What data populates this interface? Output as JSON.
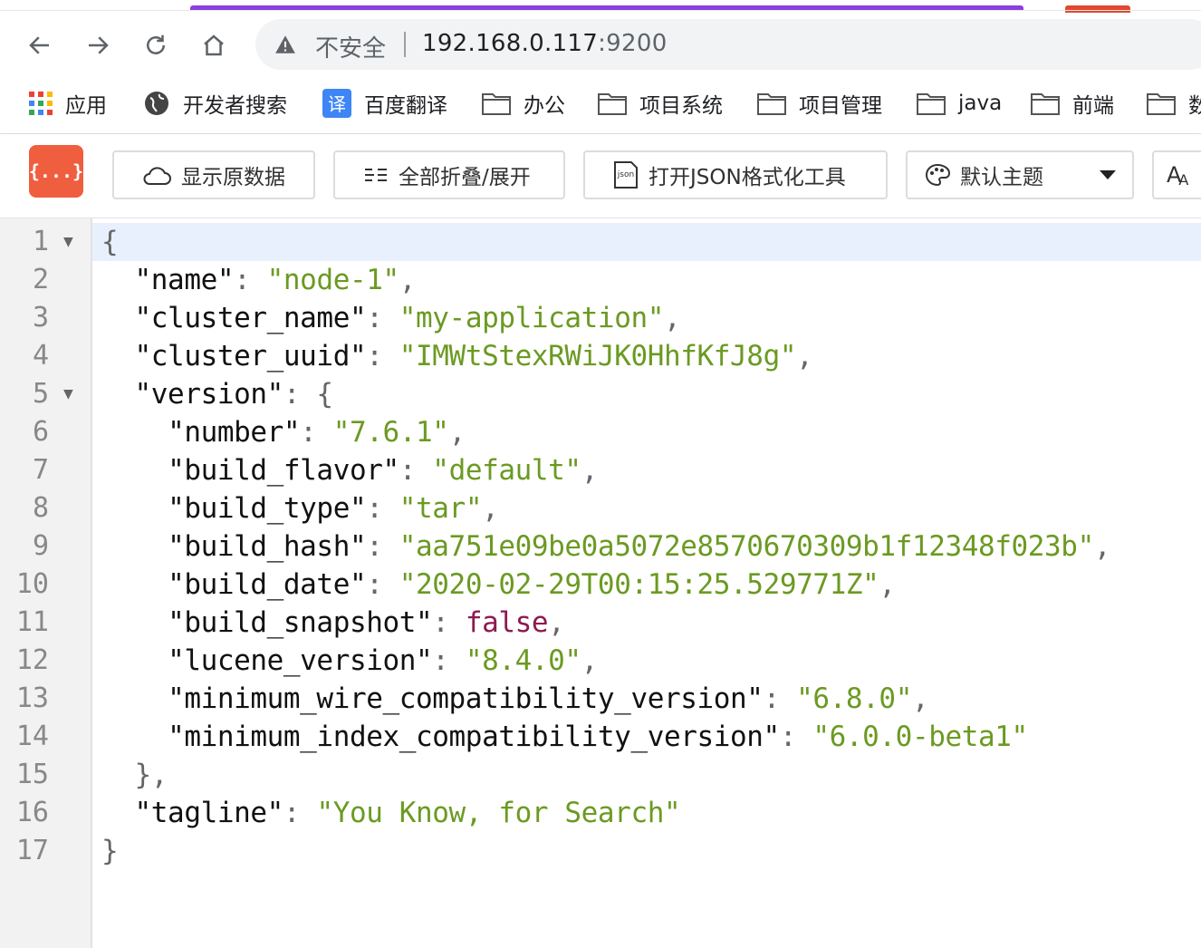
{
  "browser": {
    "insecure_label": "不安全",
    "url_host": "192.168.0.117",
    "url_port": ":9200"
  },
  "bookmarks": [
    {
      "label": "应用",
      "icon": "apps-grid-icon"
    },
    {
      "label": "开发者搜索",
      "icon": "globe-icon"
    },
    {
      "label": "百度翻译",
      "icon": "translate-icon"
    },
    {
      "label": "办公",
      "icon": "folder-icon"
    },
    {
      "label": "项目系统",
      "icon": "folder-icon"
    },
    {
      "label": "项目管理",
      "icon": "folder-icon"
    },
    {
      "label": "java",
      "icon": "folder-icon"
    },
    {
      "label": "前端",
      "icon": "folder-icon"
    },
    {
      "label": "数",
      "icon": "folder-icon"
    }
  ],
  "toolbar": {
    "logo_text": "{...}",
    "raw_label": "显示原数据",
    "fold_label": "全部折叠/展开",
    "open_tool_label": "打开JSON格式化工具",
    "theme_label": "默认主题",
    "font_label": "A"
  },
  "code": {
    "lines": [
      {
        "n": "1",
        "fold": true
      },
      {
        "n": "2"
      },
      {
        "n": "3"
      },
      {
        "n": "4"
      },
      {
        "n": "5",
        "fold": true
      },
      {
        "n": "6"
      },
      {
        "n": "7"
      },
      {
        "n": "8"
      },
      {
        "n": "9"
      },
      {
        "n": "10"
      },
      {
        "n": "11"
      },
      {
        "n": "12"
      },
      {
        "n": "13"
      },
      {
        "n": "14"
      },
      {
        "n": "15"
      },
      {
        "n": "16"
      },
      {
        "n": "17"
      }
    ],
    "json": {
      "name": "node-1",
      "cluster_name": "my-application",
      "cluster_uuid": "IMWtStexRWiJK0HhfKfJ8g",
      "version": {
        "number": "7.6.1",
        "build_flavor": "default",
        "build_type": "tar",
        "build_hash": "aa751e09be0a5072e8570670309b1f12348f023b",
        "build_date": "2020-02-29T00:15:25.529771Z",
        "build_snapshot": "false",
        "lucene_version": "8.4.0",
        "minimum_wire_compatibility_version": "6.8.0",
        "minimum_index_compatibility_version": "6.0.0-beta1"
      },
      "tagline": "You Know, for Search"
    }
  },
  "colors": {
    "string": "#6b9a22",
    "boolean": "#8c1a50",
    "key": "#111111",
    "logo": "#ef5e3e",
    "tab_accent": "#8a3fe0"
  }
}
